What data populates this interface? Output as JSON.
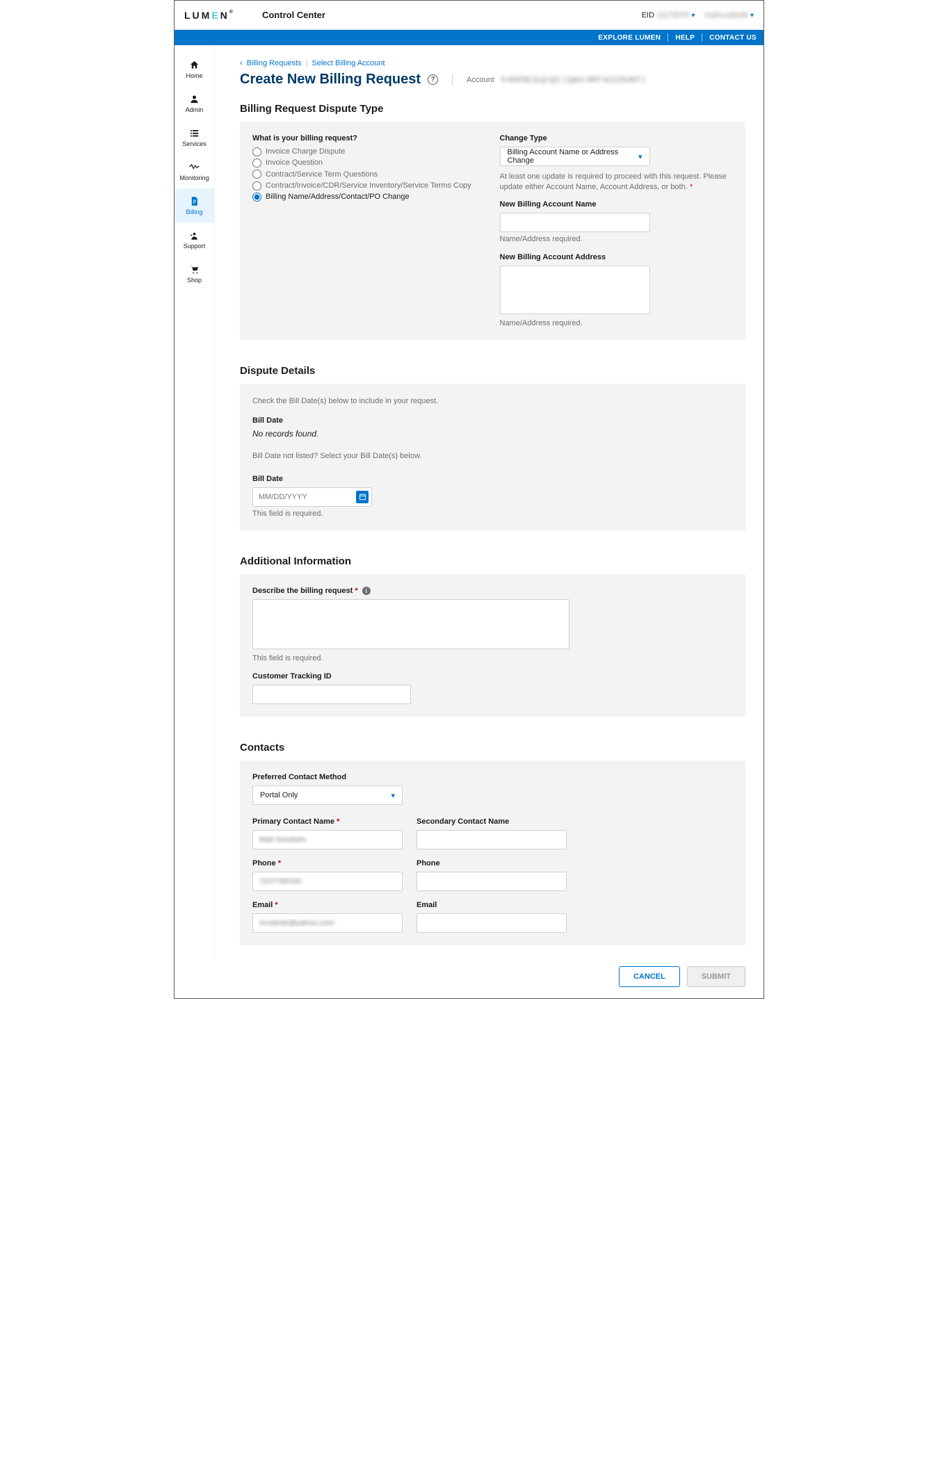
{
  "header": {
    "logo_pre": "LUM",
    "logo_e": "E",
    "logo_post": "N",
    "app_title": "Control Center",
    "eid_label": "EID",
    "eid_value": "11170076",
    "user_name": "mahcustest6"
  },
  "bluestrip": {
    "explore": "EXPLORE LUMEN",
    "help": "HELP",
    "contact": "CONTACT US"
  },
  "sidebar": {
    "items": [
      {
        "icon": "home-icon",
        "glyph": "⌂",
        "label": "Home"
      },
      {
        "icon": "admin-icon",
        "glyph": "●",
        "label": "Admin"
      },
      {
        "icon": "services-icon",
        "glyph": "☰",
        "label": "Services"
      },
      {
        "icon": "monitoring-icon",
        "glyph": "〜",
        "label": "Monitoring"
      },
      {
        "icon": "billing-icon",
        "glyph": "▤",
        "label": "Billing",
        "active": true
      },
      {
        "icon": "support-icon",
        "glyph": "☻",
        "label": "Support"
      },
      {
        "icon": "shop-icon",
        "glyph": "🛒",
        "label": "Shop"
      }
    ]
  },
  "breadcrumb": {
    "back_glyph": "‹",
    "a": "Billing Requests",
    "b": "Select Billing Account"
  },
  "title": "Create New Billing Request",
  "account_label": "Account",
  "account_value": "5-9GF8CJLQ-QC | Q&O SRT ACCOUNT |",
  "dispute_type": {
    "section_title": "Billing Request Dispute Type",
    "question": "What is your billing request?",
    "options": [
      "Invoice Charge Dispute",
      "Invoice Question",
      "Contract/Service Term Questions",
      "Contract/Invoice/CDR/Service Inventory/Service Terms Copy",
      "Billing Name/Address/Contact/PO Change"
    ],
    "selected_index": 4,
    "change_type_label": "Change Type",
    "change_type_value": "Billing Account Name or Address Change",
    "change_helper": "At least one update is required to proceed with this request. Please update either Account Name, Account Address, or both.",
    "new_name_label": "New Billing Account Name",
    "new_addr_label": "New Billing Account Address",
    "name_addr_err": "Name/Address required."
  },
  "dispute_details": {
    "section_title": "Dispute Details",
    "instr": "Check the Bill Date(s) below to include in your request.",
    "bill_date_label": "Bill Date",
    "no_records": "No records found.",
    "not_listed": "Bill Date not listed? Select your Bill Date(s) below.",
    "bill_date_label2": "Bill Date",
    "bill_date_placeholder": "MM/DD/YYYY",
    "bill_date_err": "This field is required."
  },
  "addl": {
    "section_title": "Additional Information",
    "describe_label": "Describe the billing request",
    "describe_err": "This field is required.",
    "tracking_label": "Customer Tracking ID"
  },
  "contacts": {
    "section_title": "Contacts",
    "pref_label": "Preferred Contact Method",
    "pref_value": "Portal Only",
    "primary_name_label": "Primary Contact Name",
    "secondary_name_label": "Secondary Contact Name",
    "phone_label": "Phone",
    "email_label": "Email",
    "primary_name_value": "Matt Goodwin",
    "primary_phone_value": "7207786330",
    "primary_email_value": "mcstesfs@yahoo.com"
  },
  "footer": {
    "cancel": "CANCEL",
    "submit": "SUBMIT"
  }
}
